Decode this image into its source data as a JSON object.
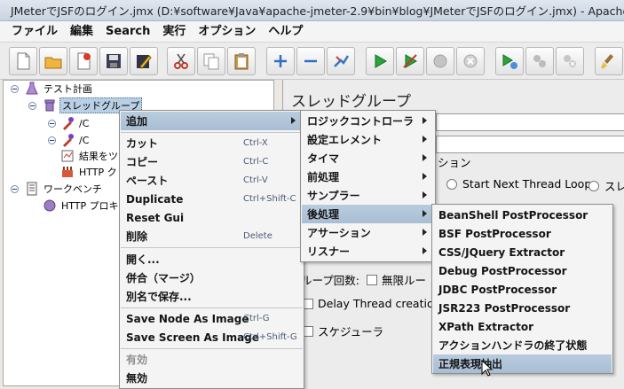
{
  "window": {
    "title": "JMeterでJSFのログイン.jmx (D:¥software¥Java¥apache-jmeter-2.9¥bin¥blog¥JMeterでJSFのログイン.jmx) - Apache"
  },
  "menubar": [
    "ファイル",
    "編集",
    "Search",
    "実行",
    "オプション",
    "ヘルプ"
  ],
  "toolbar": {
    "buttons": [
      "new-icon",
      "open-icon",
      "template-icon",
      "save-icon",
      "edit-icon",
      "cut-icon",
      "copy-icon",
      "paste-icon",
      "expand-icon",
      "collapse-icon",
      "toggle-icon",
      "start-icon",
      "start-no-timers-icon",
      "stop-icon",
      "shutdown-icon",
      "remote-start-icon",
      "remote-stop-icon",
      "remote-shutdown-icon",
      "clear-icon"
    ]
  },
  "tree": {
    "test_plan": "テスト計画",
    "thread_group": "スレッドグループ",
    "sampler1": "/C",
    "sampler2": "/C",
    "listener": "結果をツ",
    "http": "HTTP ク",
    "workbench": "ワークベンチ",
    "proxy": "HTTP プロキ"
  },
  "panel": {
    "heading": "スレッドグループ",
    "section_action": "ション",
    "radio_start_next": "Start Next Thread Loop",
    "radio_next": "スレ",
    "loop_label": "ループ回数:",
    "infinite_loop": "無限ルー",
    "delay_thread": "Delay Thread creation u",
    "scheduler": "スケジューラ"
  },
  "context_menu": {
    "items": [
      {
        "label": "追加",
        "shortcut": "",
        "submenu": true,
        "highlighted": true
      },
      {
        "label": "カット",
        "shortcut": "Ctrl-X"
      },
      {
        "label": "コピー",
        "shortcut": "Ctrl-C"
      },
      {
        "label": "ペースト",
        "shortcut": "Ctrl-V"
      },
      {
        "label": "Duplicate",
        "shortcut": "Ctrl+Shift-C"
      },
      {
        "label": "Reset Gui",
        "shortcut": ""
      },
      {
        "label": "削除",
        "shortcut": "Delete"
      },
      {
        "label": "開く...",
        "shortcut": ""
      },
      {
        "label": "併合（マージ）",
        "shortcut": ""
      },
      {
        "label": "別名で保存...",
        "shortcut": ""
      },
      {
        "label": "Save Node As Image",
        "shortcut": "Ctrl-G"
      },
      {
        "label": "Save Screen As Image",
        "shortcut": "Ctrl+Shift-G"
      },
      {
        "label": "有効",
        "shortcut": "",
        "disabled": true
      },
      {
        "label": "無効",
        "shortcut": ""
      }
    ]
  },
  "add_submenu": {
    "items": [
      "ロジックコントローラ",
      "設定エレメント",
      "タイマ",
      "前処理",
      "サンプラー",
      "後処理",
      "アサーション",
      "リスナー"
    ]
  },
  "post_submenu": {
    "items": [
      "BeanShell PostProcessor",
      "BSF PostProcessor",
      "CSS/JQuery Extractor",
      "Debug PostProcessor",
      "JDBC PostProcessor",
      "JSR223 PostProcessor",
      "XPath Extractor",
      "アクションハンドラの終了状態",
      "正規表現抽出"
    ]
  }
}
